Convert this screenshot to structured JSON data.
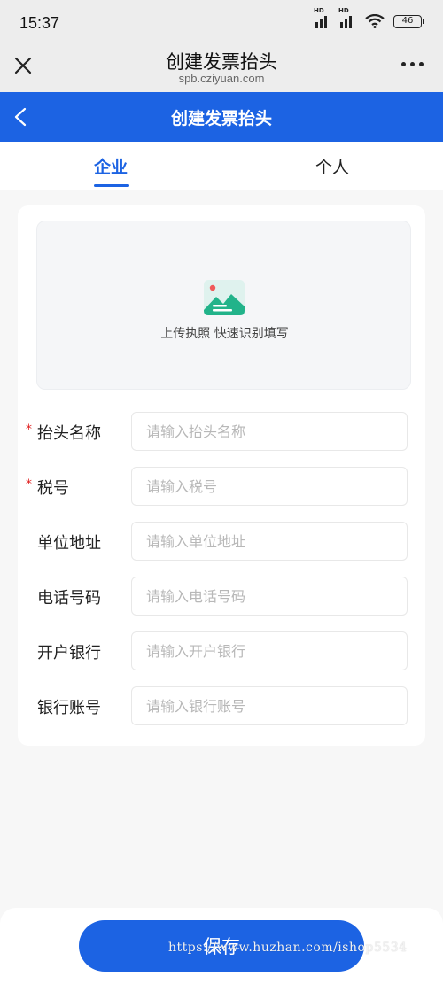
{
  "status_bar": {
    "time": "15:37",
    "battery": "46",
    "hd_label": "HD"
  },
  "web_header": {
    "title": "创建发票抬头",
    "url": "spb.cziyuan.com"
  },
  "nav": {
    "title": "创建发票抬头"
  },
  "tabs": [
    {
      "label": "企业",
      "active": true
    },
    {
      "label": "个人",
      "active": false
    }
  ],
  "upload": {
    "text": "上传执照 快速识别填写"
  },
  "fields": [
    {
      "label": "抬头名称",
      "placeholder": "请输入抬头名称",
      "required": true,
      "value": ""
    },
    {
      "label": "税号",
      "placeholder": "请输入税号",
      "required": true,
      "value": ""
    },
    {
      "label": "单位地址",
      "placeholder": "请输入单位地址",
      "required": false,
      "value": ""
    },
    {
      "label": "电话号码",
      "placeholder": "请输入电话号码",
      "required": false,
      "value": ""
    },
    {
      "label": "开户银行",
      "placeholder": "请输入开户银行",
      "required": false,
      "value": ""
    },
    {
      "label": "银行账号",
      "placeholder": "请输入银行账号",
      "required": false,
      "value": ""
    }
  ],
  "required_mark": "*",
  "save_label": "保存",
  "watermark": "https://www.huzhan.com/ishop5534",
  "colors": {
    "primary": "#1c63e3",
    "required": "#e02020",
    "placeholder": "#b8b8b8"
  }
}
